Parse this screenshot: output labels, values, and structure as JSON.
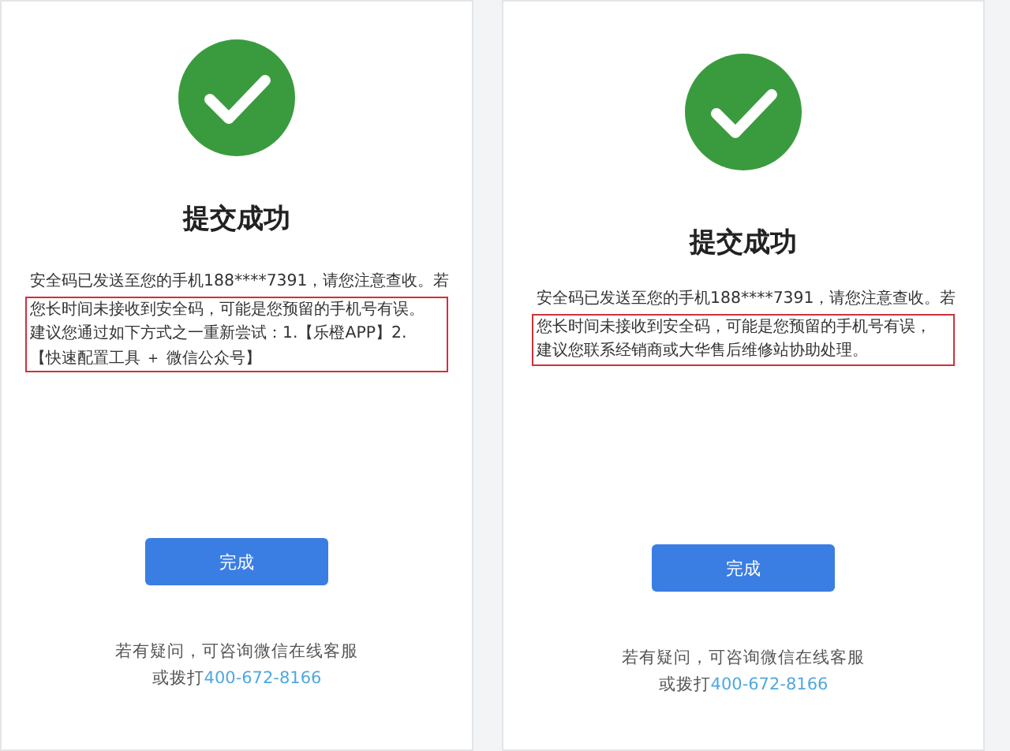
{
  "panels": [
    {
      "title": "提交成功",
      "intro_lines": [
        "安全码已发送至您的手机188****7391，请您注意查收。若"
      ],
      "highlighted_lines": [
        "您长时间未接收到安全码，可能是您预留的手机号有误。",
        "建议您通过如下方式之一重新尝试：1.【乐橙APP】2.",
        "【快速配置工具 ＋ 微信公众号】"
      ],
      "button": "完成",
      "help": "若有疑问，可咨询微信在线客服",
      "call_prefix": "或拨打",
      "phone": "400-672-8166"
    },
    {
      "title": "提交成功",
      "intro_lines": [
        "安全码已发送至您的手机188****7391，请您注意查收。若"
      ],
      "highlighted_lines": [
        "您长时间未接收到安全码，可能是您预留的手机号有误，",
        "建议您联系经销商或大华售后维修站协助处理。"
      ],
      "button": "完成",
      "help": "若有疑问，可咨询微信在线客服",
      "call_prefix": "或拨打",
      "phone": "400-672-8166"
    }
  ]
}
